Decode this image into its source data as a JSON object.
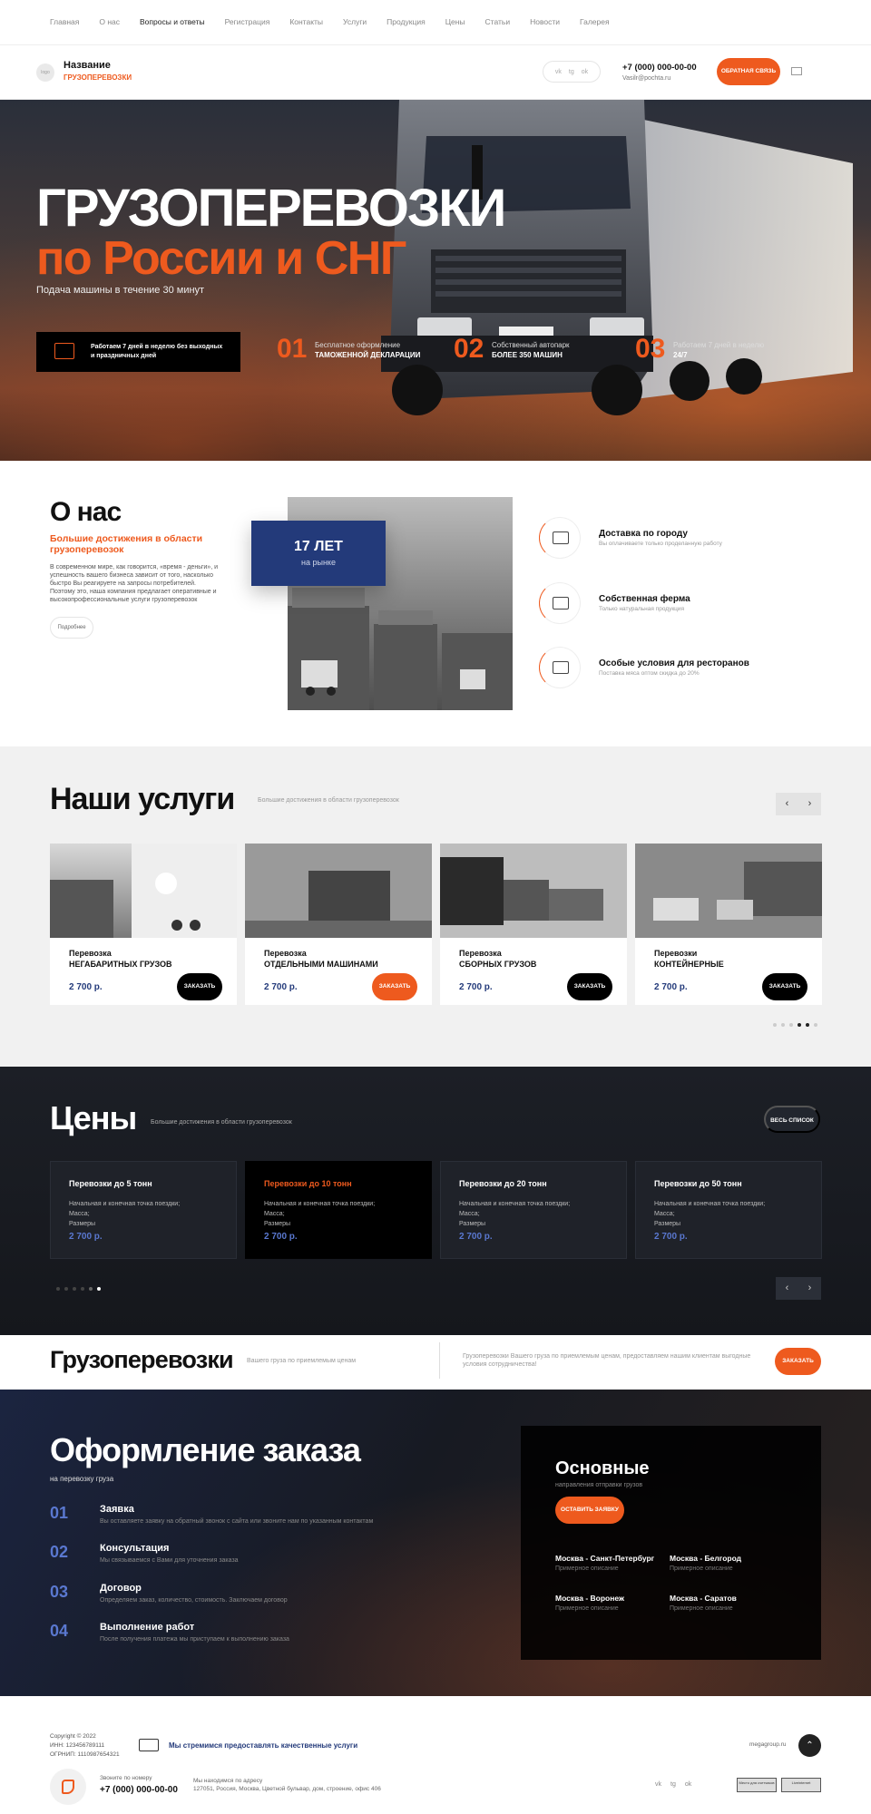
{
  "topnav": [
    "Главная",
    "О нас",
    "Вопросы и ответы",
    "Регистрация",
    "Контакты",
    "Услуги",
    "Продукция",
    "Цены",
    "Статьи",
    "Новости",
    "Галерея"
  ],
  "header": {
    "logo_text": "logo",
    "brand_name": "Название",
    "brand_sub": "ГРУЗОПЕРЕВОЗКИ",
    "socials": [
      "vk",
      "tg",
      "ok"
    ],
    "phone": "+7 (000) 000-00-00",
    "email": "Vasilr@pochta.ru",
    "callback": "ОБРАТНАЯ СВЯЗЬ"
  },
  "hero": {
    "title": "ГРУЗОПЕРЕВОЗКИ",
    "subtitle": "по России и СНГ",
    "tagline": "Подача машины в течение 30 минут",
    "box_text": "Работаем 7 дней в неделю без выходных и праздничных дней",
    "stats": [
      {
        "num": "01",
        "l1": "Бесплатное оформление",
        "l2": "ТАМОЖЕННОЙ ДЕКЛАРАЦИИ"
      },
      {
        "num": "02",
        "l1": "Собственный автопарк",
        "l2": "БОЛЕЕ 350 МАШИН"
      },
      {
        "num": "03",
        "l1": "Работаем 7 дней в неделю",
        "l2": "24/7"
      }
    ]
  },
  "about": {
    "title": "О нас",
    "subtitle": "Большие достижения в области грузоперевозок",
    "description": "В современном мире, как говорится, «время - деньги», и успешность вашего бизнеса зависит от того, насколько быстро Вы реагируете на запросы потребителей. Поэтому это, наша компания предлагает оперативные и высокопрофессиональные услуги грузоперевозок",
    "more": "Подробнее",
    "years": "17 ЛЕТ",
    "years_sub": "на рынке",
    "features": [
      {
        "icon": "truck-icon",
        "title": "Доставка по городу",
        "desc": "Вы оплачиваете только проделанную работу"
      },
      {
        "icon": "farm-icon",
        "title": "Собственная ферма",
        "desc": "Только натуральная продукция"
      },
      {
        "icon": "restaurant-icon",
        "title": "Особые условия для ресторанов",
        "desc": "Поставка мяса оптом скидка до 20%"
      }
    ]
  },
  "services": {
    "title": "Наши услуги",
    "subtitle": "Большие достижения в области грузоперевозок",
    "cards": [
      {
        "line1": "Перевозка",
        "line2": "НЕГАБАРИТНЫХ ГРУЗОВ",
        "price": "2 700 р.",
        "button": "ЗАКАЗАТЬ"
      },
      {
        "line1": "Перевозка",
        "line2": "ОТДЕЛЬНЫМИ МАШИНАМИ",
        "price": "2 700 р.",
        "button": "ЗАКАЗАТЬ"
      },
      {
        "line1": "Перевозка",
        "line2": "СБОРНЫХ ГРУЗОВ",
        "price": "2 700 р.",
        "button": "ЗАКАЗАТЬ"
      },
      {
        "line1": "Перевозки",
        "line2": "КОНТЕЙНЕРНЫЕ",
        "price": "2 700 р.",
        "button": "ЗАКАЗАТЬ"
      }
    ]
  },
  "prices": {
    "title": "Цены",
    "subtitle": "Большие достижения в области грузоперевозок",
    "all": "ВЕСЬ СПИСОК",
    "cards": [
      {
        "title": "Перевозки до 5 тонн",
        "d1": "Начальная и конечная точка поездки;",
        "d2": "Масса;",
        "d3": "Размеры",
        "price": "2 700 р."
      },
      {
        "title": "Перевозки до 10 тонн",
        "d1": "Начальная и конечная точка поездки;",
        "d2": "Масса;",
        "d3": "Размеры",
        "price": "2 700 р."
      },
      {
        "title": "Перевозки до 20 тонн",
        "d1": "Начальная и конечная точка поездки;",
        "d2": "Масса;",
        "d3": "Размеры",
        "price": "2 700 р."
      },
      {
        "title": "Перевозки до 50 тонн",
        "d1": "Начальная и конечная точка поездки;",
        "d2": "Масса;",
        "d3": "Размеры",
        "price": "2 700 р."
      }
    ]
  },
  "strip": {
    "title": "Грузоперевозки",
    "subtitle": "Вашего груза по приемлемым ценам",
    "description": "Грузоперевозки Вашего груза по приемлемым ценам, предоставляем нашим клиентам выгодные условия сотрудничества!",
    "button": "ЗАКАЗАТЬ"
  },
  "order": {
    "title": "Оформление заказа",
    "subtitle": "на перевозку груза",
    "steps": [
      {
        "num": "01",
        "title": "Заявка",
        "desc": "Вы оставляете заявку на обратный звонок с сайта или звоните нам по указанным контактам"
      },
      {
        "num": "02",
        "title": "Консультация",
        "desc": "Мы связываемся с Вами для уточнения заказа"
      },
      {
        "num": "03",
        "title": "Договор",
        "desc": "Определяем заказ, количество, стоимость. Заключаем договор"
      },
      {
        "num": "04",
        "title": "Выполнение работ",
        "desc": "После получения платежа мы приступаем к выполнению заказа"
      }
    ],
    "directions_title": "Основные",
    "directions_sub": "направления отправки грузов",
    "directions_btn": "ОСТАВИТЬ ЗАЯВКУ",
    "routes": [
      {
        "title": "Москва - Санкт-Петербург",
        "desc": "Примерное описание"
      },
      {
        "title": "Москва - Белгород",
        "desc": "Примерное описание"
      },
      {
        "title": "Москва - Воронеж",
        "desc": "Примерное описание"
      },
      {
        "title": "Москва - Саратов",
        "desc": "Примерное описание"
      }
    ]
  },
  "footer": {
    "copy1": "Copyright © 2022",
    "copy2": "ИНН: 123456789111",
    "copy3": "ОГРНИП: 1110987654321",
    "claim": "Мы стремимся предоставлять качественные услуги",
    "site": "megagroup.ru",
    "call_label": "Звоните по номеру",
    "phone": "+7 (000) 000-00-00",
    "addr_label": "Мы находимся по адресу",
    "addr": "127051, Россия, Москва, Цветной бульвар, дом, строение, офис 406",
    "socials": [
      "vk",
      "tg",
      "ok"
    ],
    "badge1": "Место для счетчиков",
    "badge2": "Liveinternet"
  },
  "colors": {
    "accent": "#ee5a1e",
    "navy": "#233a7a",
    "price_blue": "#5a78d0",
    "dark": "#1c1f26"
  }
}
